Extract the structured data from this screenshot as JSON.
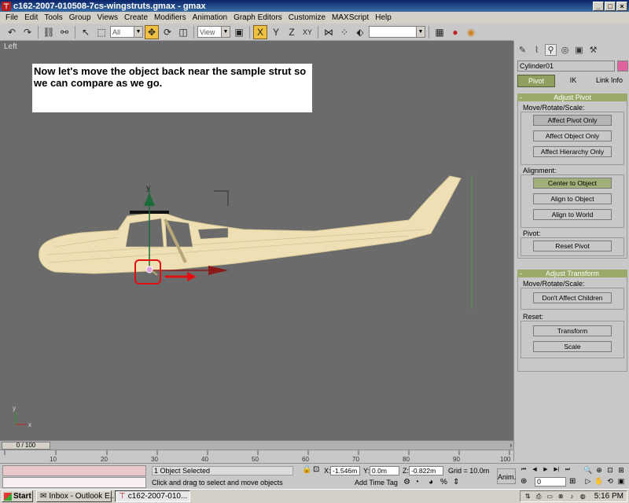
{
  "window": {
    "title": "c162-2007-010508-7cs-wingstruts.gmax - gmax",
    "icon": "gmax-app-icon",
    "controls": [
      "_",
      "□",
      "×"
    ]
  },
  "menu": [
    "File",
    "Edit",
    "Tools",
    "Group",
    "Views",
    "Create",
    "Modifiers",
    "Animation",
    "Graph Editors",
    "Customize",
    "MAXScript",
    "Help"
  ],
  "toolbar": {
    "selection_filter": "All",
    "reference_coord": "View",
    "axis_x": "X",
    "axis_y": "Y",
    "axis_z": "Z",
    "axis_xy": "XY"
  },
  "viewport": {
    "label": "Left",
    "callout_text": "Now let's move the object back near the sample strut so we can compare as we go.",
    "axis_x_label": "x",
    "axis_y_label": "y",
    "gizmo_y_label": "y"
  },
  "command_panel": {
    "object_name": "Cylinder01",
    "object_color": "#e0609e",
    "sub_tabs": [
      "Pivot",
      "IK",
      "Link Info"
    ],
    "active_sub_tab": "Pivot",
    "adjust_pivot": {
      "title": "Adjust Pivot",
      "move_group_label": "Move/Rotate/Scale:",
      "affect_pivot_only": "Affect Pivot Only",
      "affect_object_only": "Affect Object Only",
      "affect_hierarchy_only": "Affect Hierarchy Only",
      "alignment_label": "Alignment:",
      "center_to_object": "Center to Object",
      "align_to_object": "Align to Object",
      "align_to_world": "Align to World",
      "pivot_label": "Pivot:",
      "reset_pivot": "Reset Pivot"
    },
    "adjust_transform": {
      "title": "Adjust Transform",
      "move_group_label": "Move/Rotate/Scale:",
      "dont_affect_children": "Don't Affect Children",
      "reset_label": "Reset:",
      "transform": "Transform",
      "scale": "Scale"
    }
  },
  "time_slider": {
    "position": "0 / 100",
    "ticks": [
      "10",
      "20",
      "30",
      "40",
      "50",
      "60",
      "70",
      "80",
      "90",
      "100"
    ]
  },
  "status": {
    "selection": "1 Object Selected",
    "prompt": "Click and drag to select and move objects",
    "x_label": "X:",
    "x_value": "-1.546m",
    "y_label": "Y:",
    "y_value": "0.0m",
    "z_label": "Z:",
    "z_value": "-0.822m",
    "grid": "Grid = 10.0m",
    "add_time_tag": "Add Time Tag",
    "anim_label": "Anim.",
    "current_frame": "0"
  },
  "taskbar": {
    "start_label": "Start",
    "tasks": [
      {
        "label": "Inbox - Outlook E...",
        "active": false
      },
      {
        "label": "c162-2007-010...",
        "active": true
      }
    ],
    "clock": "5:16 PM"
  }
}
